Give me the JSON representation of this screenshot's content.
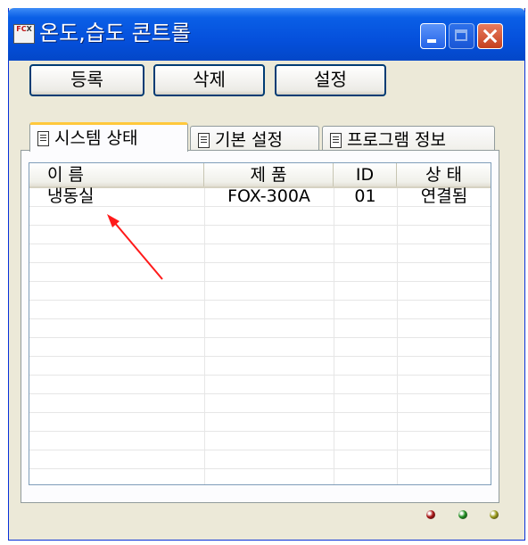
{
  "window": {
    "title": "온도,습도 콘트롤",
    "icon_name": "fox-app-icon",
    "controls": [
      "minimize-icon",
      "maximize-icon",
      "close-icon"
    ]
  },
  "toolbar": {
    "register_label": "등록",
    "delete_label": "삭제",
    "settings_label": "설정"
  },
  "tabs": [
    {
      "label": "시스템 상태",
      "active": true
    },
    {
      "label": "기본 설정",
      "active": false
    },
    {
      "label": "프로그램 정보",
      "active": false
    }
  ],
  "table": {
    "columns": [
      "이 름",
      "제 품",
      "ID",
      "상 태"
    ],
    "rows": [
      {
        "name": "냉동실",
        "product": "FOX-300A",
        "id": "01",
        "status": "연결됨"
      }
    ]
  },
  "status_leds": [
    {
      "color": "#a81010"
    },
    {
      "color": "#1e8c1e"
    },
    {
      "color": "#9a9a18"
    }
  ],
  "annotation": {
    "color": "#ff1a1a"
  }
}
